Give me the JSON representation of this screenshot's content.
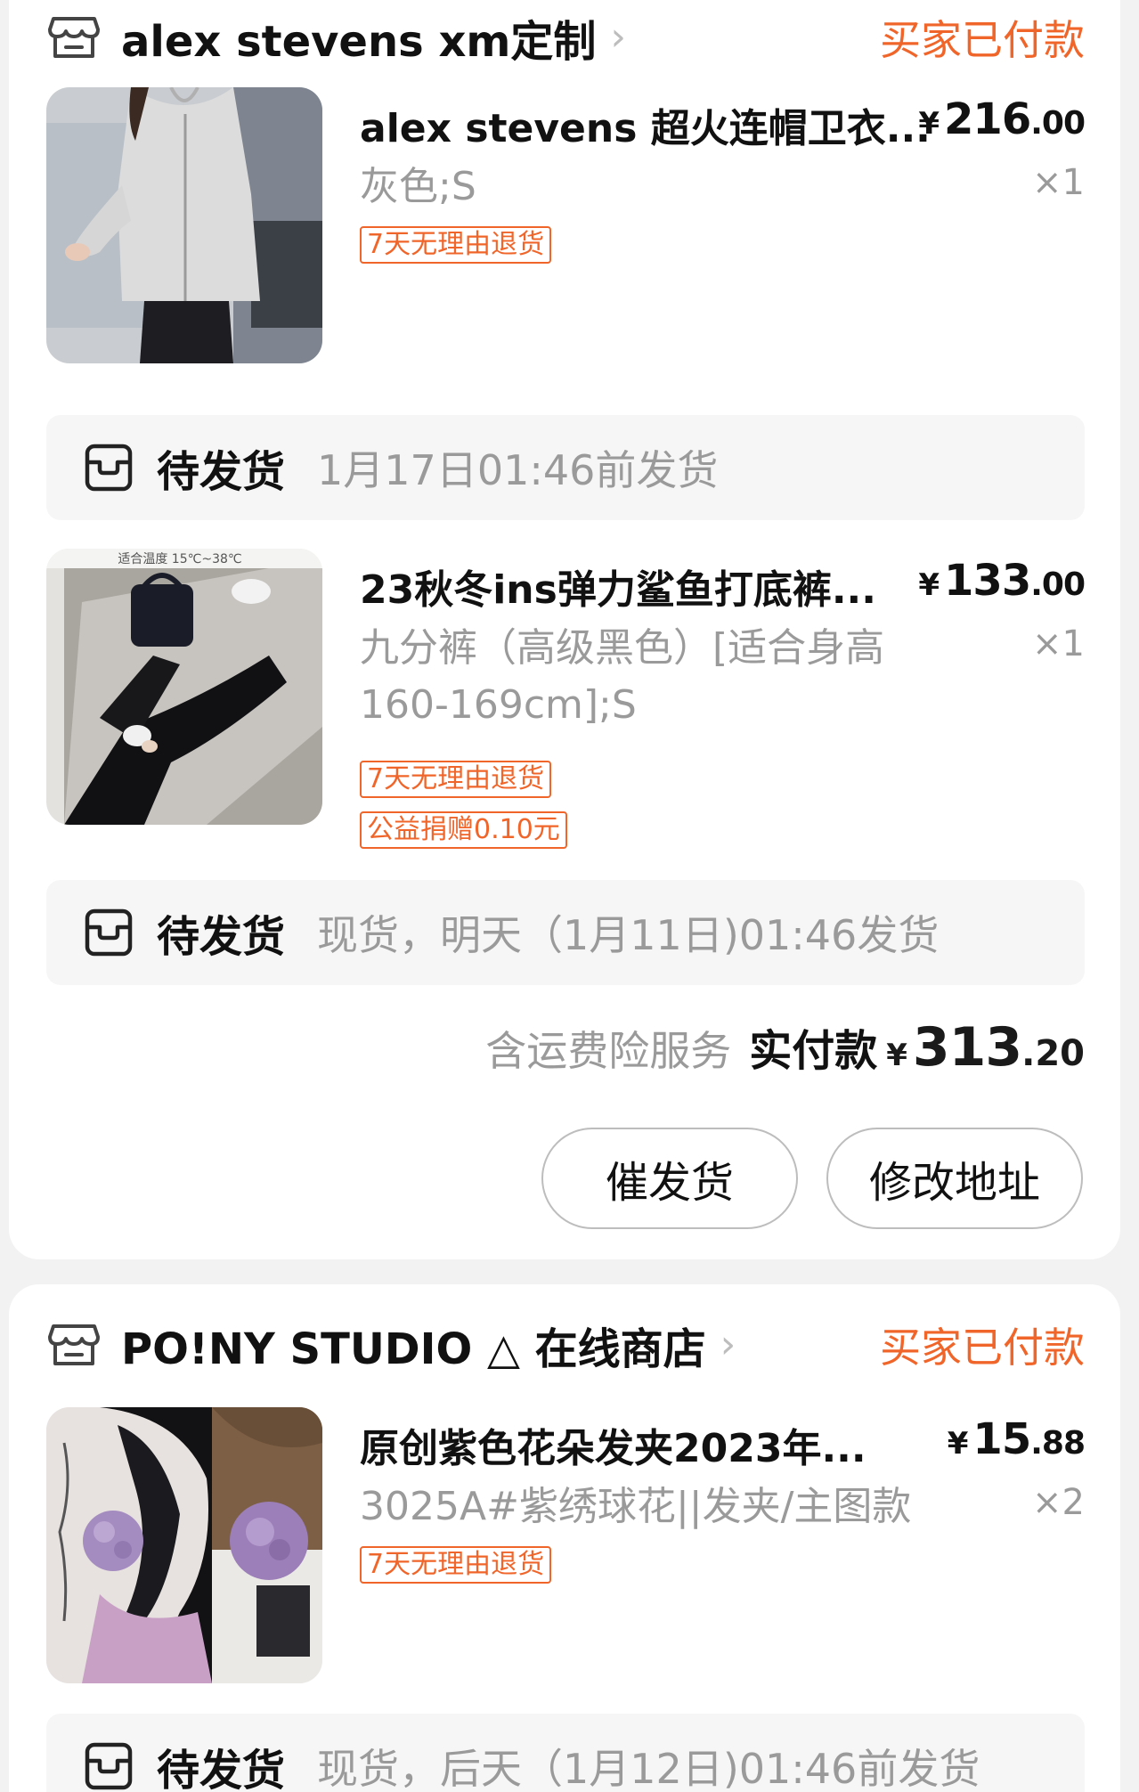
{
  "stores": [
    {
      "name": "alex stevens  xm定制",
      "order_status": "买家已付款",
      "items": [
        {
          "title": "alex stevens 超火连帽卫衣...",
          "price_currency": "¥",
          "price_int": "216",
          "price_dec": ".00",
          "variant": "灰色;S",
          "qty": "×1",
          "tags": [
            "7天无理由退货"
          ],
          "ship_label": "待发货",
          "ship_note": "1月17日01:46前发货",
          "image_text": ""
        },
        {
          "title": "23秋冬ins弹力鲨鱼打底裤...",
          "price_currency": "¥",
          "price_int": "133",
          "price_dec": ".00",
          "variant": "九分裤（高级黑色）[适合身高160-169cm];S",
          "qty": "×1",
          "tags": [
            "7天无理由退货",
            "公益捐赠0.10元"
          ],
          "ship_label": "待发货",
          "ship_note": "现货，明天（1月11日)01:46发货",
          "image_text": "适合温度 15℃~38℃"
        }
      ],
      "total": {
        "note": "含运费险服务",
        "label": "实付款",
        "currency": "¥",
        "int": "313",
        "dec": ".20"
      },
      "buttons": {
        "remind": "催发货",
        "address": "修改地址"
      }
    },
    {
      "name": "PO!NY STUDIO △ 在线商店",
      "order_status": "买家已付款",
      "items": [
        {
          "title": "原创紫色花朵发夹2023年...",
          "price_currency": "¥",
          "price_int": "15",
          "price_dec": ".88",
          "variant": "3025A#紫绣球花||发夹/主图款",
          "qty": "×2",
          "tags": [
            "7天无理由退货"
          ],
          "ship_label": "待发货",
          "ship_note": "现货，后天（1月12日)01:46前发货"
        }
      ]
    }
  ],
  "colors": {
    "accent": "#f0652a",
    "text": "#111111",
    "muted": "#9a9a9a",
    "card": "#ffffff",
    "page_bg": "#f2f2f2"
  },
  "icons": {
    "store": "store-icon",
    "ship": "package-icon",
    "chevron": "chevron-right-icon"
  }
}
